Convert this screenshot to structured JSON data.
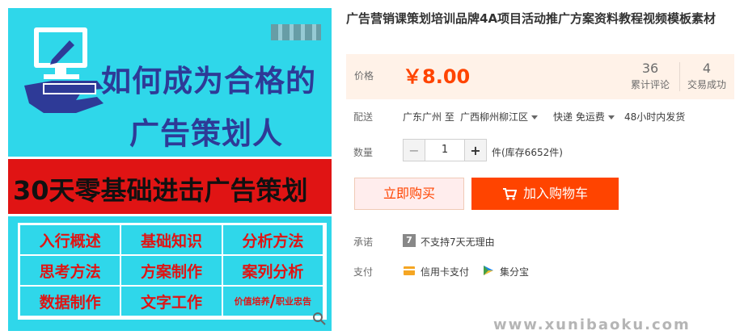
{
  "image": {
    "headline_1": "如何成为合格的",
    "headline_2": "广告策划人",
    "banner": "30天零基础进击广告策划",
    "topics": [
      "入行概述",
      "基础知识",
      "分析方法",
      "思考方法",
      "方案制作",
      "案列分析",
      "数据制作",
      "文字工作"
    ],
    "last_topic_a": "价值培养",
    "last_topic_b": "/",
    "last_topic_c": "职业忠告"
  },
  "product": {
    "title": "广告营销课策划培训品牌4A项目活动推广方案资料教程视频模板素材"
  },
  "price": {
    "label": "价格",
    "value": "￥8.00",
    "reviews_count": "36",
    "reviews_label": "累计评论",
    "sold_count": "4",
    "sold_label": "交易成功"
  },
  "shipping": {
    "label": "配送",
    "from": "广东广州 至",
    "to": "广西柳州柳江区",
    "method": "快递 免运费",
    "ship_time": "48小时内发货"
  },
  "quantity": {
    "label": "数量",
    "minus": "−",
    "value": "1",
    "plus": "+",
    "stock": "件(库存6652件)"
  },
  "actions": {
    "buy_now": "立即购买",
    "add_to_cart": "加入购物车"
  },
  "promise": {
    "label": "承诺",
    "badge": "7",
    "text": "不支持7天无理由"
  },
  "payment": {
    "label": "支付",
    "method_1": "信用卡支付",
    "method_2": "集分宝"
  },
  "watermark": "www.xunibaoku.com",
  "colors": {
    "accent": "#ff4400",
    "price_bg": "#fff2e8",
    "image_bg": "#2fd7ea",
    "banner_red": "#e01414"
  }
}
